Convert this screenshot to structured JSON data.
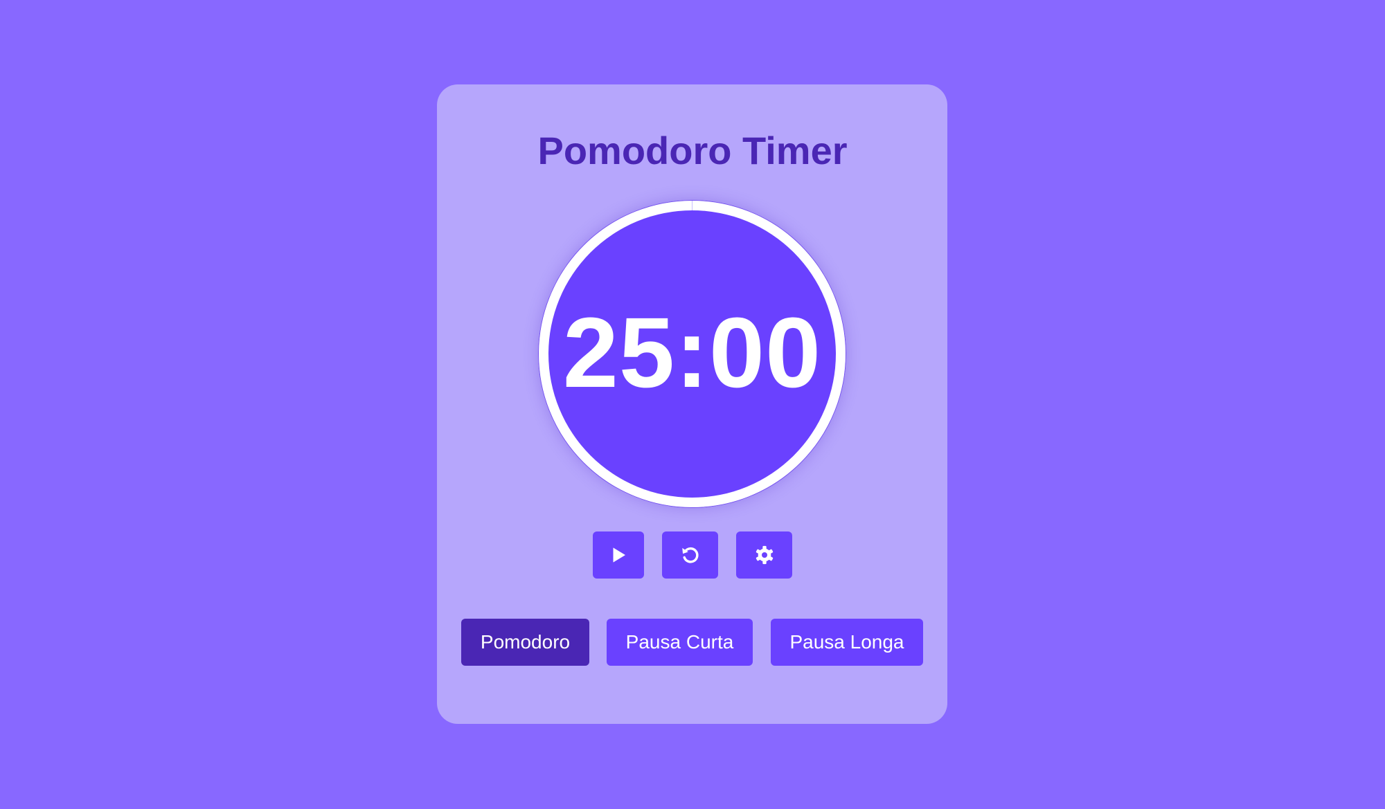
{
  "app": {
    "title": "Pomodoro Timer"
  },
  "timer": {
    "display": "25:00",
    "progress_fraction": 0
  },
  "controls": {
    "play": {
      "icon": "play-icon"
    },
    "reset": {
      "icon": "reset-icon"
    },
    "settings": {
      "icon": "gear-icon"
    }
  },
  "modes": [
    {
      "label": "Pomodoro",
      "active": true
    },
    {
      "label": "Pausa Curta",
      "active": false
    },
    {
      "label": "Pausa Longa",
      "active": false
    }
  ],
  "colors": {
    "background": "#8868ff",
    "card": "#b6a6fc",
    "accent": "#6a41ff",
    "active": "#4a26b4",
    "title": "#4a26b4",
    "text_on_accent": "#ffffff"
  }
}
